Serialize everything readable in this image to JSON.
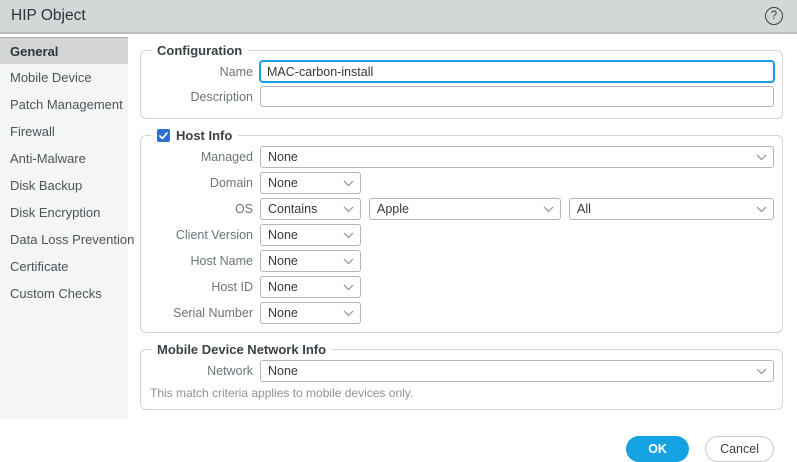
{
  "window": {
    "title": "HIP Object",
    "help_symbol": "?"
  },
  "sidebar": {
    "items": [
      {
        "label": "General",
        "selected": true
      },
      {
        "label": "Mobile Device",
        "selected": false
      },
      {
        "label": "Patch Management",
        "selected": false
      },
      {
        "label": "Firewall",
        "selected": false
      },
      {
        "label": "Anti-Malware",
        "selected": false
      },
      {
        "label": "Disk Backup",
        "selected": false
      },
      {
        "label": "Disk Encryption",
        "selected": false
      },
      {
        "label": "Data Loss Prevention",
        "selected": false
      },
      {
        "label": "Certificate",
        "selected": false
      },
      {
        "label": "Custom Checks",
        "selected": false
      }
    ]
  },
  "form": {
    "configuration": {
      "legend": "Configuration",
      "name_label": "Name",
      "name_value": "MAC-carbon-install",
      "description_label": "Description",
      "description_value": ""
    },
    "host_info": {
      "legend": "Host Info",
      "checkbox_checked": true,
      "managed_label": "Managed",
      "managed_value": "None",
      "domain_label": "Domain",
      "domain_value": "None",
      "os_label": "OS",
      "os_match_value": "Contains",
      "os_vendor_value": "Apple",
      "os_version_value": "All",
      "client_version_label": "Client Version",
      "client_version_value": "None",
      "host_name_label": "Host Name",
      "host_name_value": "None",
      "host_id_label": "Host ID",
      "host_id_value": "None",
      "serial_number_label": "Serial Number",
      "serial_number_value": "None"
    },
    "mobile_device_network_info": {
      "legend": "Mobile Device Network Info",
      "network_label": "Network",
      "network_value": "None",
      "note": "This match criteria applies to mobile devices only."
    }
  },
  "footer": {
    "ok_label": "OK",
    "cancel_label": "Cancel"
  },
  "colors": {
    "titlebar_bg": "#d4d7d8",
    "sidebar_selected_bg": "#d3d5d5",
    "checkbox_blue": "#2e6fd0",
    "focus_border_blue": "#189fe1",
    "ok_button_blue": "#14a2e2"
  }
}
